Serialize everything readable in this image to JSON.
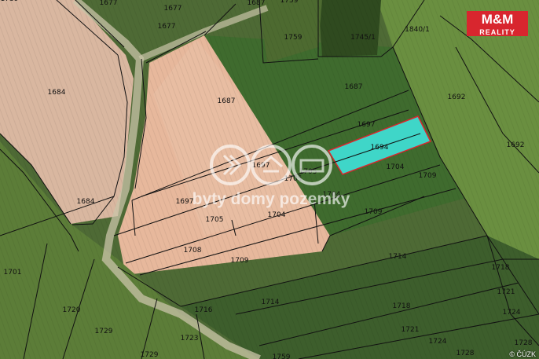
{
  "brand": {
    "name": "M&M",
    "sub": "REALITY"
  },
  "watermark": "byty domy pozemky",
  "credit": "© ČÚZK",
  "highlight_color": "#3fd6c8",
  "parcels": [
    {
      "id": "1677",
      "name": "parcel-1677-a"
    },
    {
      "id": "1677",
      "name": "parcel-1677-b"
    },
    {
      "id": "1677",
      "name": "parcel-1677-c"
    },
    {
      "id": "1687",
      "name": "parcel-1687-a"
    },
    {
      "id": "1759",
      "name": "parcel-1759-a"
    },
    {
      "id": "1759",
      "name": "parcel-1759-b"
    },
    {
      "id": "1745/1",
      "name": "parcel-1745-1"
    },
    {
      "id": "1840/1",
      "name": "parcel-1840-1"
    },
    {
      "id": "1684",
      "name": "parcel-1684-a"
    },
    {
      "id": "1687",
      "name": "parcel-1687-b"
    },
    {
      "id": "1687",
      "name": "parcel-1687-c"
    },
    {
      "id": "1692",
      "name": "parcel-1692-a"
    },
    {
      "id": "1697",
      "name": "parcel-1697-a"
    },
    {
      "id": "1694",
      "name": "parcel-1694"
    },
    {
      "id": "1692",
      "name": "parcel-1692-b"
    },
    {
      "id": "1697",
      "name": "parcel-1697-b"
    },
    {
      "id": "1704",
      "name": "parcel-1704-a"
    },
    {
      "id": "1705",
      "name": "parcel-1705-a"
    },
    {
      "id": "1709",
      "name": "parcel-1709-a"
    },
    {
      "id": "1705",
      "name": "parcel-1705-b"
    },
    {
      "id": "1704",
      "name": "parcel-1704-b"
    },
    {
      "id": "1684",
      "name": "parcel-1684-b"
    },
    {
      "id": "1697",
      "name": "parcel-1697-c"
    },
    {
      "id": "1709",
      "name": "parcel-1709-b"
    },
    {
      "id": "1705",
      "name": "parcel-1705-c"
    },
    {
      "id": "1704",
      "name": "parcel-1704-c"
    },
    {
      "id": "1708",
      "name": "parcel-1708"
    },
    {
      "id": "1709",
      "name": "parcel-1709-c"
    },
    {
      "id": "1714",
      "name": "parcel-1714-a"
    },
    {
      "id": "1718",
      "name": "parcel-1718-a"
    },
    {
      "id": "1701",
      "name": "parcel-1701"
    },
    {
      "id": "1714",
      "name": "parcel-1714-b"
    },
    {
      "id": "1721",
      "name": "parcel-1721-a"
    },
    {
      "id": "1716",
      "name": "parcel-1716"
    },
    {
      "id": "1718",
      "name": "parcel-1718-b"
    },
    {
      "id": "1724",
      "name": "parcel-1724-a"
    },
    {
      "id": "1720",
      "name": "parcel-1720"
    },
    {
      "id": "1729",
      "name": "parcel-1729-a"
    },
    {
      "id": "1723",
      "name": "parcel-1723"
    },
    {
      "id": "1721",
      "name": "parcel-1721-b"
    },
    {
      "id": "1724",
      "name": "parcel-1724-b"
    },
    {
      "id": "1728",
      "name": "parcel-1728-a"
    },
    {
      "id": "1728",
      "name": "parcel-1728-b"
    },
    {
      "id": "1729",
      "name": "parcel-1729-b"
    },
    {
      "id": "1759",
      "name": "parcel-1759-c"
    },
    {
      "id": "1739",
      "name": "parcel-1739"
    }
  ]
}
